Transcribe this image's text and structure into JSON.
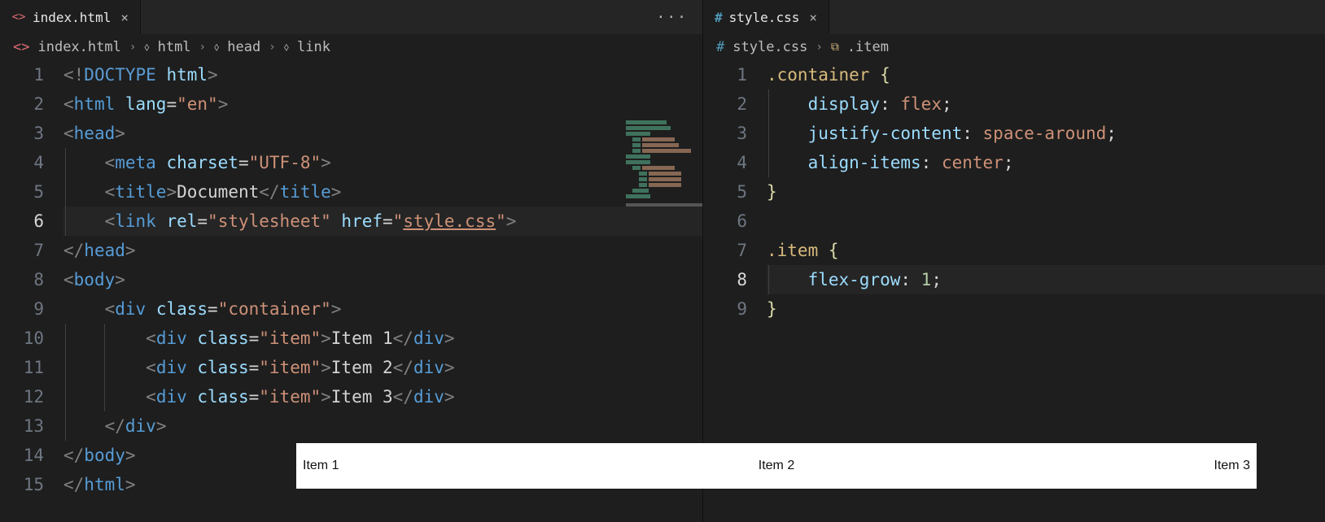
{
  "left": {
    "tab": {
      "filename": "index.html"
    },
    "breadcrumb": [
      "index.html",
      "html",
      "head",
      "link"
    ],
    "activeLine": 6,
    "lines": [
      [
        {
          "c": "c-gray",
          "t": "<!"
        },
        {
          "c": "c-doc",
          "t": "DOCTYPE "
        },
        {
          "c": "c-attr",
          "t": "html"
        },
        {
          "c": "c-gray",
          "t": ">"
        }
      ],
      [
        {
          "c": "c-gray",
          "t": "<"
        },
        {
          "c": "c-tag",
          "t": "html "
        },
        {
          "c": "c-attr",
          "t": "lang"
        },
        {
          "c": "c-txt",
          "t": "="
        },
        {
          "c": "c-str",
          "t": "\"en\""
        },
        {
          "c": "c-gray",
          "t": ">"
        }
      ],
      [
        {
          "c": "c-gray",
          "t": "<"
        },
        {
          "c": "c-tag",
          "t": "head"
        },
        {
          "c": "c-gray",
          "t": ">"
        }
      ],
      [
        {
          "c": "",
          "t": "    "
        },
        {
          "c": "c-gray",
          "t": "<"
        },
        {
          "c": "c-tag",
          "t": "meta "
        },
        {
          "c": "c-attr",
          "t": "charset"
        },
        {
          "c": "c-txt",
          "t": "="
        },
        {
          "c": "c-str",
          "t": "\"UTF-8\""
        },
        {
          "c": "c-gray",
          "t": ">"
        }
      ],
      [
        {
          "c": "",
          "t": "    "
        },
        {
          "c": "c-gray",
          "t": "<"
        },
        {
          "c": "c-tag",
          "t": "title"
        },
        {
          "c": "c-gray",
          "t": ">"
        },
        {
          "c": "c-txt",
          "t": "Document"
        },
        {
          "c": "c-gray",
          "t": "</"
        },
        {
          "c": "c-tag",
          "t": "title"
        },
        {
          "c": "c-gray",
          "t": ">"
        }
      ],
      [
        {
          "c": "",
          "t": "    "
        },
        {
          "c": "c-gray",
          "t": "<"
        },
        {
          "c": "c-tag",
          "t": "link "
        },
        {
          "c": "c-attr",
          "t": "rel"
        },
        {
          "c": "c-txt",
          "t": "="
        },
        {
          "c": "c-str",
          "t": "\"stylesheet\" "
        },
        {
          "c": "c-attr",
          "t": "href"
        },
        {
          "c": "c-txt",
          "t": "="
        },
        {
          "c": "c-str",
          "t": "\""
        },
        {
          "c": "c-str underline",
          "t": "style.css"
        },
        {
          "c": "c-str",
          "t": "\""
        },
        {
          "c": "c-gray",
          "t": ">"
        }
      ],
      [
        {
          "c": "c-gray",
          "t": "</"
        },
        {
          "c": "c-tag",
          "t": "head"
        },
        {
          "c": "c-gray",
          "t": ">"
        }
      ],
      [
        {
          "c": "c-gray",
          "t": "<"
        },
        {
          "c": "c-tag",
          "t": "body"
        },
        {
          "c": "c-gray",
          "t": ">"
        }
      ],
      [
        {
          "c": "",
          "t": "    "
        },
        {
          "c": "c-gray",
          "t": "<"
        },
        {
          "c": "c-tag",
          "t": "div "
        },
        {
          "c": "c-attr",
          "t": "class"
        },
        {
          "c": "c-txt",
          "t": "="
        },
        {
          "c": "c-str",
          "t": "\"container\""
        },
        {
          "c": "c-gray",
          "t": ">"
        }
      ],
      [
        {
          "c": "",
          "t": "        "
        },
        {
          "c": "c-gray",
          "t": "<"
        },
        {
          "c": "c-tag",
          "t": "div "
        },
        {
          "c": "c-attr",
          "t": "class"
        },
        {
          "c": "c-txt",
          "t": "="
        },
        {
          "c": "c-str",
          "t": "\"item\""
        },
        {
          "c": "c-gray",
          "t": ">"
        },
        {
          "c": "c-txt",
          "t": "Item 1"
        },
        {
          "c": "c-gray",
          "t": "</"
        },
        {
          "c": "c-tag",
          "t": "div"
        },
        {
          "c": "c-gray",
          "t": ">"
        }
      ],
      [
        {
          "c": "",
          "t": "        "
        },
        {
          "c": "c-gray",
          "t": "<"
        },
        {
          "c": "c-tag",
          "t": "div "
        },
        {
          "c": "c-attr",
          "t": "class"
        },
        {
          "c": "c-txt",
          "t": "="
        },
        {
          "c": "c-str",
          "t": "\"item\""
        },
        {
          "c": "c-gray",
          "t": ">"
        },
        {
          "c": "c-txt",
          "t": "Item 2"
        },
        {
          "c": "c-gray",
          "t": "</"
        },
        {
          "c": "c-tag",
          "t": "div"
        },
        {
          "c": "c-gray",
          "t": ">"
        }
      ],
      [
        {
          "c": "",
          "t": "        "
        },
        {
          "c": "c-gray",
          "t": "<"
        },
        {
          "c": "c-tag",
          "t": "div "
        },
        {
          "c": "c-attr",
          "t": "class"
        },
        {
          "c": "c-txt",
          "t": "="
        },
        {
          "c": "c-str",
          "t": "\"item\""
        },
        {
          "c": "c-gray",
          "t": ">"
        },
        {
          "c": "c-txt",
          "t": "Item 3"
        },
        {
          "c": "c-gray",
          "t": "</"
        },
        {
          "c": "c-tag",
          "t": "div"
        },
        {
          "c": "c-gray",
          "t": ">"
        }
      ],
      [
        {
          "c": "",
          "t": "    "
        },
        {
          "c": "c-gray",
          "t": "</"
        },
        {
          "c": "c-tag",
          "t": "div"
        },
        {
          "c": "c-gray",
          "t": ">"
        }
      ],
      [
        {
          "c": "c-gray",
          "t": "</"
        },
        {
          "c": "c-tag",
          "t": "body"
        },
        {
          "c": "c-gray",
          "t": ">"
        }
      ],
      [
        {
          "c": "c-gray",
          "t": "</"
        },
        {
          "c": "c-tag",
          "t": "html"
        },
        {
          "c": "c-gray",
          "t": ">"
        }
      ]
    ],
    "indentGuides": [
      {
        "line": 4,
        "levels": [
          1
        ]
      },
      {
        "line": 5,
        "levels": [
          1
        ]
      },
      {
        "line": 6,
        "levels": [
          1
        ]
      },
      {
        "line": 10,
        "levels": [
          1,
          2
        ]
      },
      {
        "line": 11,
        "levels": [
          1,
          2
        ]
      },
      {
        "line": 12,
        "levels": [
          1,
          2
        ]
      },
      {
        "line": 13,
        "levels": [
          1
        ]
      }
    ]
  },
  "right": {
    "tab": {
      "filename": "style.css"
    },
    "breadcrumb": [
      "style.css",
      ".item"
    ],
    "activeLine": 8,
    "lines": [
      [
        {
          "c": "c-sel",
          "t": ".container "
        },
        {
          "c": "c-brace",
          "t": "{"
        }
      ],
      [
        {
          "c": "",
          "t": "    "
        },
        {
          "c": "c-prop",
          "t": "display"
        },
        {
          "c": "c-txt",
          "t": ": "
        },
        {
          "c": "c-val",
          "t": "flex"
        },
        {
          "c": "c-txt",
          "t": ";"
        }
      ],
      [
        {
          "c": "",
          "t": "    "
        },
        {
          "c": "c-prop",
          "t": "justify-content"
        },
        {
          "c": "c-txt",
          "t": ": "
        },
        {
          "c": "c-val",
          "t": "space-around"
        },
        {
          "c": "c-txt",
          "t": ";"
        }
      ],
      [
        {
          "c": "",
          "t": "    "
        },
        {
          "c": "c-prop",
          "t": "align-items"
        },
        {
          "c": "c-txt",
          "t": ": "
        },
        {
          "c": "c-val",
          "t": "center"
        },
        {
          "c": "c-txt",
          "t": ";"
        }
      ],
      [
        {
          "c": "c-brace",
          "t": "}"
        }
      ],
      [],
      [
        {
          "c": "c-sel",
          "t": ".item "
        },
        {
          "c": "c-brace",
          "t": "{"
        }
      ],
      [
        {
          "c": "",
          "t": "    "
        },
        {
          "c": "c-prop",
          "t": "flex-grow"
        },
        {
          "c": "c-txt",
          "t": ": "
        },
        {
          "c": "c-num",
          "t": "1"
        },
        {
          "c": "c-txt",
          "t": ";"
        }
      ],
      [
        {
          "c": "c-brace",
          "t": "}"
        }
      ]
    ],
    "indentGuides": [
      {
        "line": 2,
        "levels": [
          1
        ]
      },
      {
        "line": 3,
        "levels": [
          1
        ]
      },
      {
        "line": 4,
        "levels": [
          1
        ]
      },
      {
        "line": 8,
        "levels": [
          1
        ]
      }
    ]
  },
  "preview": {
    "items": [
      "Item 1",
      "Item 2",
      "Item 3"
    ]
  },
  "overflowGlyph": "···"
}
